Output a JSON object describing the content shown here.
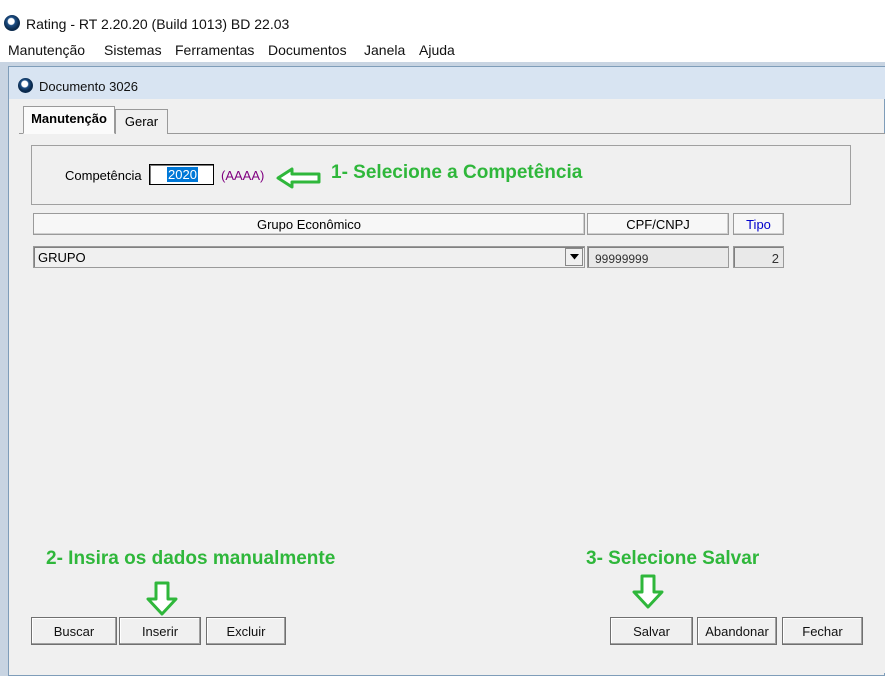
{
  "app": {
    "title": "Rating - RT 2.20.20 (Build 1013) BD 22.03"
  },
  "menu": {
    "items": [
      "Manutenção",
      "Sistemas",
      "Ferramentas",
      "Documentos",
      "Janela",
      "Ajuda"
    ]
  },
  "document": {
    "title": "Documento 3026",
    "tabs": [
      {
        "label": "Manutenção",
        "active": true
      },
      {
        "label": "Gerar",
        "active": false
      }
    ],
    "competencia": {
      "label": "Competência",
      "value": "2020",
      "hint": "(AAAA)"
    },
    "columns": {
      "grupo": "Grupo Econômico",
      "cpf": "CPF/CNPJ",
      "tipo": "Tipo"
    },
    "row": {
      "grupo": "GRUPO",
      "cpf": "99999999",
      "tipo": "2"
    },
    "buttons": {
      "buscar": "Buscar",
      "inserir": "Inserir",
      "excluir": "Excluir",
      "salvar": "Salvar",
      "abandonar": "Abandonar",
      "fechar": "Fechar"
    }
  },
  "annotations": {
    "step1": "1- Selecione a Competência",
    "step2": "2- Insira os dados manualmente",
    "step3": "3- Selecione Salvar",
    "color": "#2fb73b"
  },
  "icons": {
    "app_logo": "app-logo-icon",
    "dropdown": "chevron-down-icon",
    "arrow_left": "arrow-left-icon",
    "arrow_down": "arrow-down-icon"
  }
}
